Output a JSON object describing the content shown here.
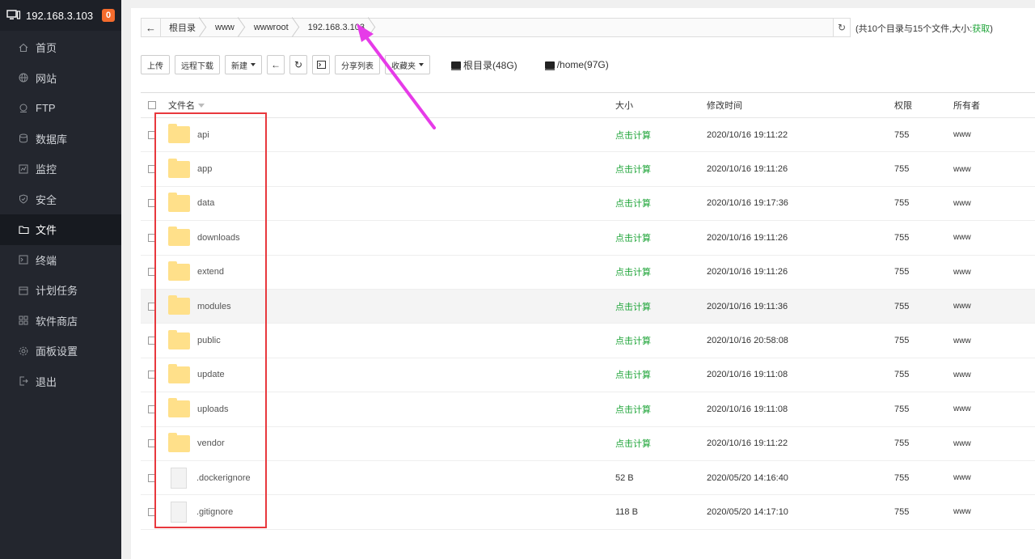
{
  "sidebar": {
    "host": "192.168.3.103",
    "badge": "0",
    "items": [
      {
        "label": "首页",
        "icon": "home-icon"
      },
      {
        "label": "网站",
        "icon": "globe-icon"
      },
      {
        "label": "FTP",
        "icon": "ftp-icon"
      },
      {
        "label": "数据库",
        "icon": "database-icon"
      },
      {
        "label": "监控",
        "icon": "monitor-icon"
      },
      {
        "label": "安全",
        "icon": "shield-icon"
      },
      {
        "label": "文件",
        "icon": "folder-icon"
      },
      {
        "label": "终端",
        "icon": "terminal-icon"
      },
      {
        "label": "计划任务",
        "icon": "calendar-icon"
      },
      {
        "label": "软件商店",
        "icon": "apps-icon"
      },
      {
        "label": "面板设置",
        "icon": "gear-icon"
      },
      {
        "label": "退出",
        "icon": "logout-icon"
      }
    ],
    "active_index": 6
  },
  "pathbar": {
    "crumbs": [
      "根目录",
      "www",
      "wwwroot",
      "192.168.3.103"
    ],
    "info_prefix": "(共10个目录与15个文件,大小:",
    "info_link": "获取",
    "info_suffix": ")"
  },
  "toolbar": {
    "upload": "上传",
    "remote_download": "远程下载",
    "new": "新建",
    "share_list": "分享列表",
    "favorites": "收藏夹",
    "disks": [
      "根目录(48G)",
      "/home(97G)"
    ]
  },
  "table": {
    "headers": {
      "name": "文件名",
      "size": "大小",
      "mtime": "修改时间",
      "perm": "权限",
      "owner": "所有者"
    },
    "rows": [
      {
        "name": "api",
        "type": "dir",
        "size": "点击计算",
        "mtime": "2020/10/16 19:11:22",
        "perm": "755",
        "owner": "www"
      },
      {
        "name": "app",
        "type": "dir",
        "size": "点击计算",
        "mtime": "2020/10/16 19:11:26",
        "perm": "755",
        "owner": "www"
      },
      {
        "name": "data",
        "type": "dir",
        "size": "点击计算",
        "mtime": "2020/10/16 19:17:36",
        "perm": "755",
        "owner": "www"
      },
      {
        "name": "downloads",
        "type": "dir",
        "size": "点击计算",
        "mtime": "2020/10/16 19:11:26",
        "perm": "755",
        "owner": "www"
      },
      {
        "name": "extend",
        "type": "dir",
        "size": "点击计算",
        "mtime": "2020/10/16 19:11:26",
        "perm": "755",
        "owner": "www"
      },
      {
        "name": "modules",
        "type": "dir",
        "size": "点击计算",
        "mtime": "2020/10/16 19:11:36",
        "perm": "755",
        "owner": "www"
      },
      {
        "name": "public",
        "type": "dir",
        "size": "点击计算",
        "mtime": "2020/10/16 20:58:08",
        "perm": "755",
        "owner": "www"
      },
      {
        "name": "update",
        "type": "dir",
        "size": "点击计算",
        "mtime": "2020/10/16 19:11:08",
        "perm": "755",
        "owner": "www"
      },
      {
        "name": "uploads",
        "type": "dir",
        "size": "点击计算",
        "mtime": "2020/10/16 19:11:08",
        "perm": "755",
        "owner": "www"
      },
      {
        "name": "vendor",
        "type": "dir",
        "size": "点击计算",
        "mtime": "2020/10/16 19:11:22",
        "perm": "755",
        "owner": "www"
      },
      {
        "name": ".dockerignore",
        "type": "file",
        "size": "52 B",
        "mtime": "2020/05/20 14:16:40",
        "perm": "755",
        "owner": "www"
      },
      {
        "name": ".gitignore",
        "type": "file",
        "size": "118 B",
        "mtime": "2020/05/20 14:17:10",
        "perm": "755",
        "owner": "www"
      }
    ],
    "highlight_index": 5
  },
  "colors": {
    "accent": "#20a53a",
    "sidebar": "#23262e",
    "annotation": "#e8383d",
    "arrow": "#e63be8"
  }
}
